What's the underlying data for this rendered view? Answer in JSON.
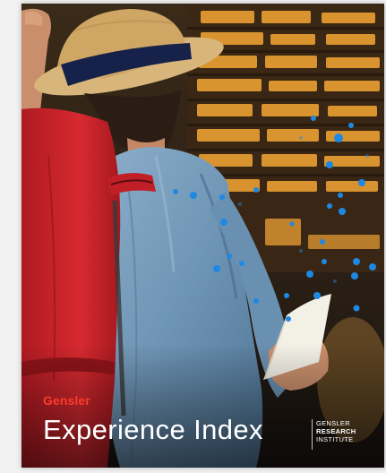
{
  "cover": {
    "brand": "Gensler",
    "title": "Experience Index",
    "institute": {
      "line1": "GENSLER",
      "line2": "RESEARCH",
      "line3": "INSTITUTE"
    },
    "colors": {
      "brand_red": "#ff3a2d",
      "dot_blue": "#1e88e5",
      "board_amber": "#e0902a"
    },
    "photo_subject": "traveler-in-hat-with-backpack-at-departure-board"
  }
}
